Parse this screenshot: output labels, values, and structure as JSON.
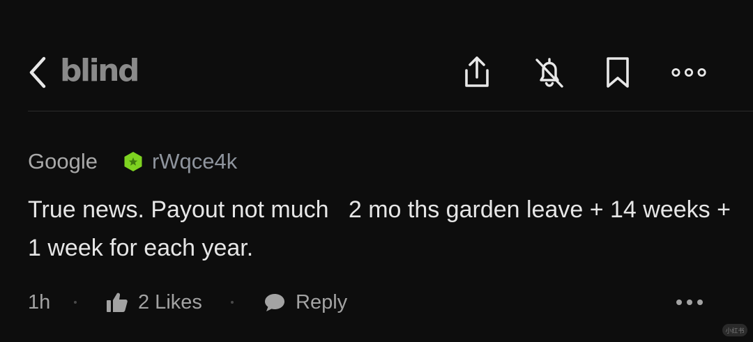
{
  "header": {
    "brand": "blind",
    "back_icon": "chevron-left-icon",
    "actions": [
      {
        "name": "share-icon"
      },
      {
        "name": "notifications-off-icon"
      },
      {
        "name": "bookmark-icon"
      },
      {
        "name": "more-horizontal-icon"
      }
    ]
  },
  "comment": {
    "company": "Google",
    "badge_icon": "verified-hexagon-icon",
    "badge_color": "#7ed321",
    "username": "rWqce4k",
    "text": "True news. Payout not much   2 mo ths garden leave + 14 weeks + 1 week for each year.",
    "time": "1h",
    "likes_label": "2 Likes",
    "reply_label": "Reply"
  },
  "colors": {
    "background": "#0d0d0d",
    "text_primary": "#e6e6e6",
    "text_secondary": "#a3a3a3",
    "accent_green": "#7ed321"
  },
  "watermark": {
    "text": "小红书"
  }
}
